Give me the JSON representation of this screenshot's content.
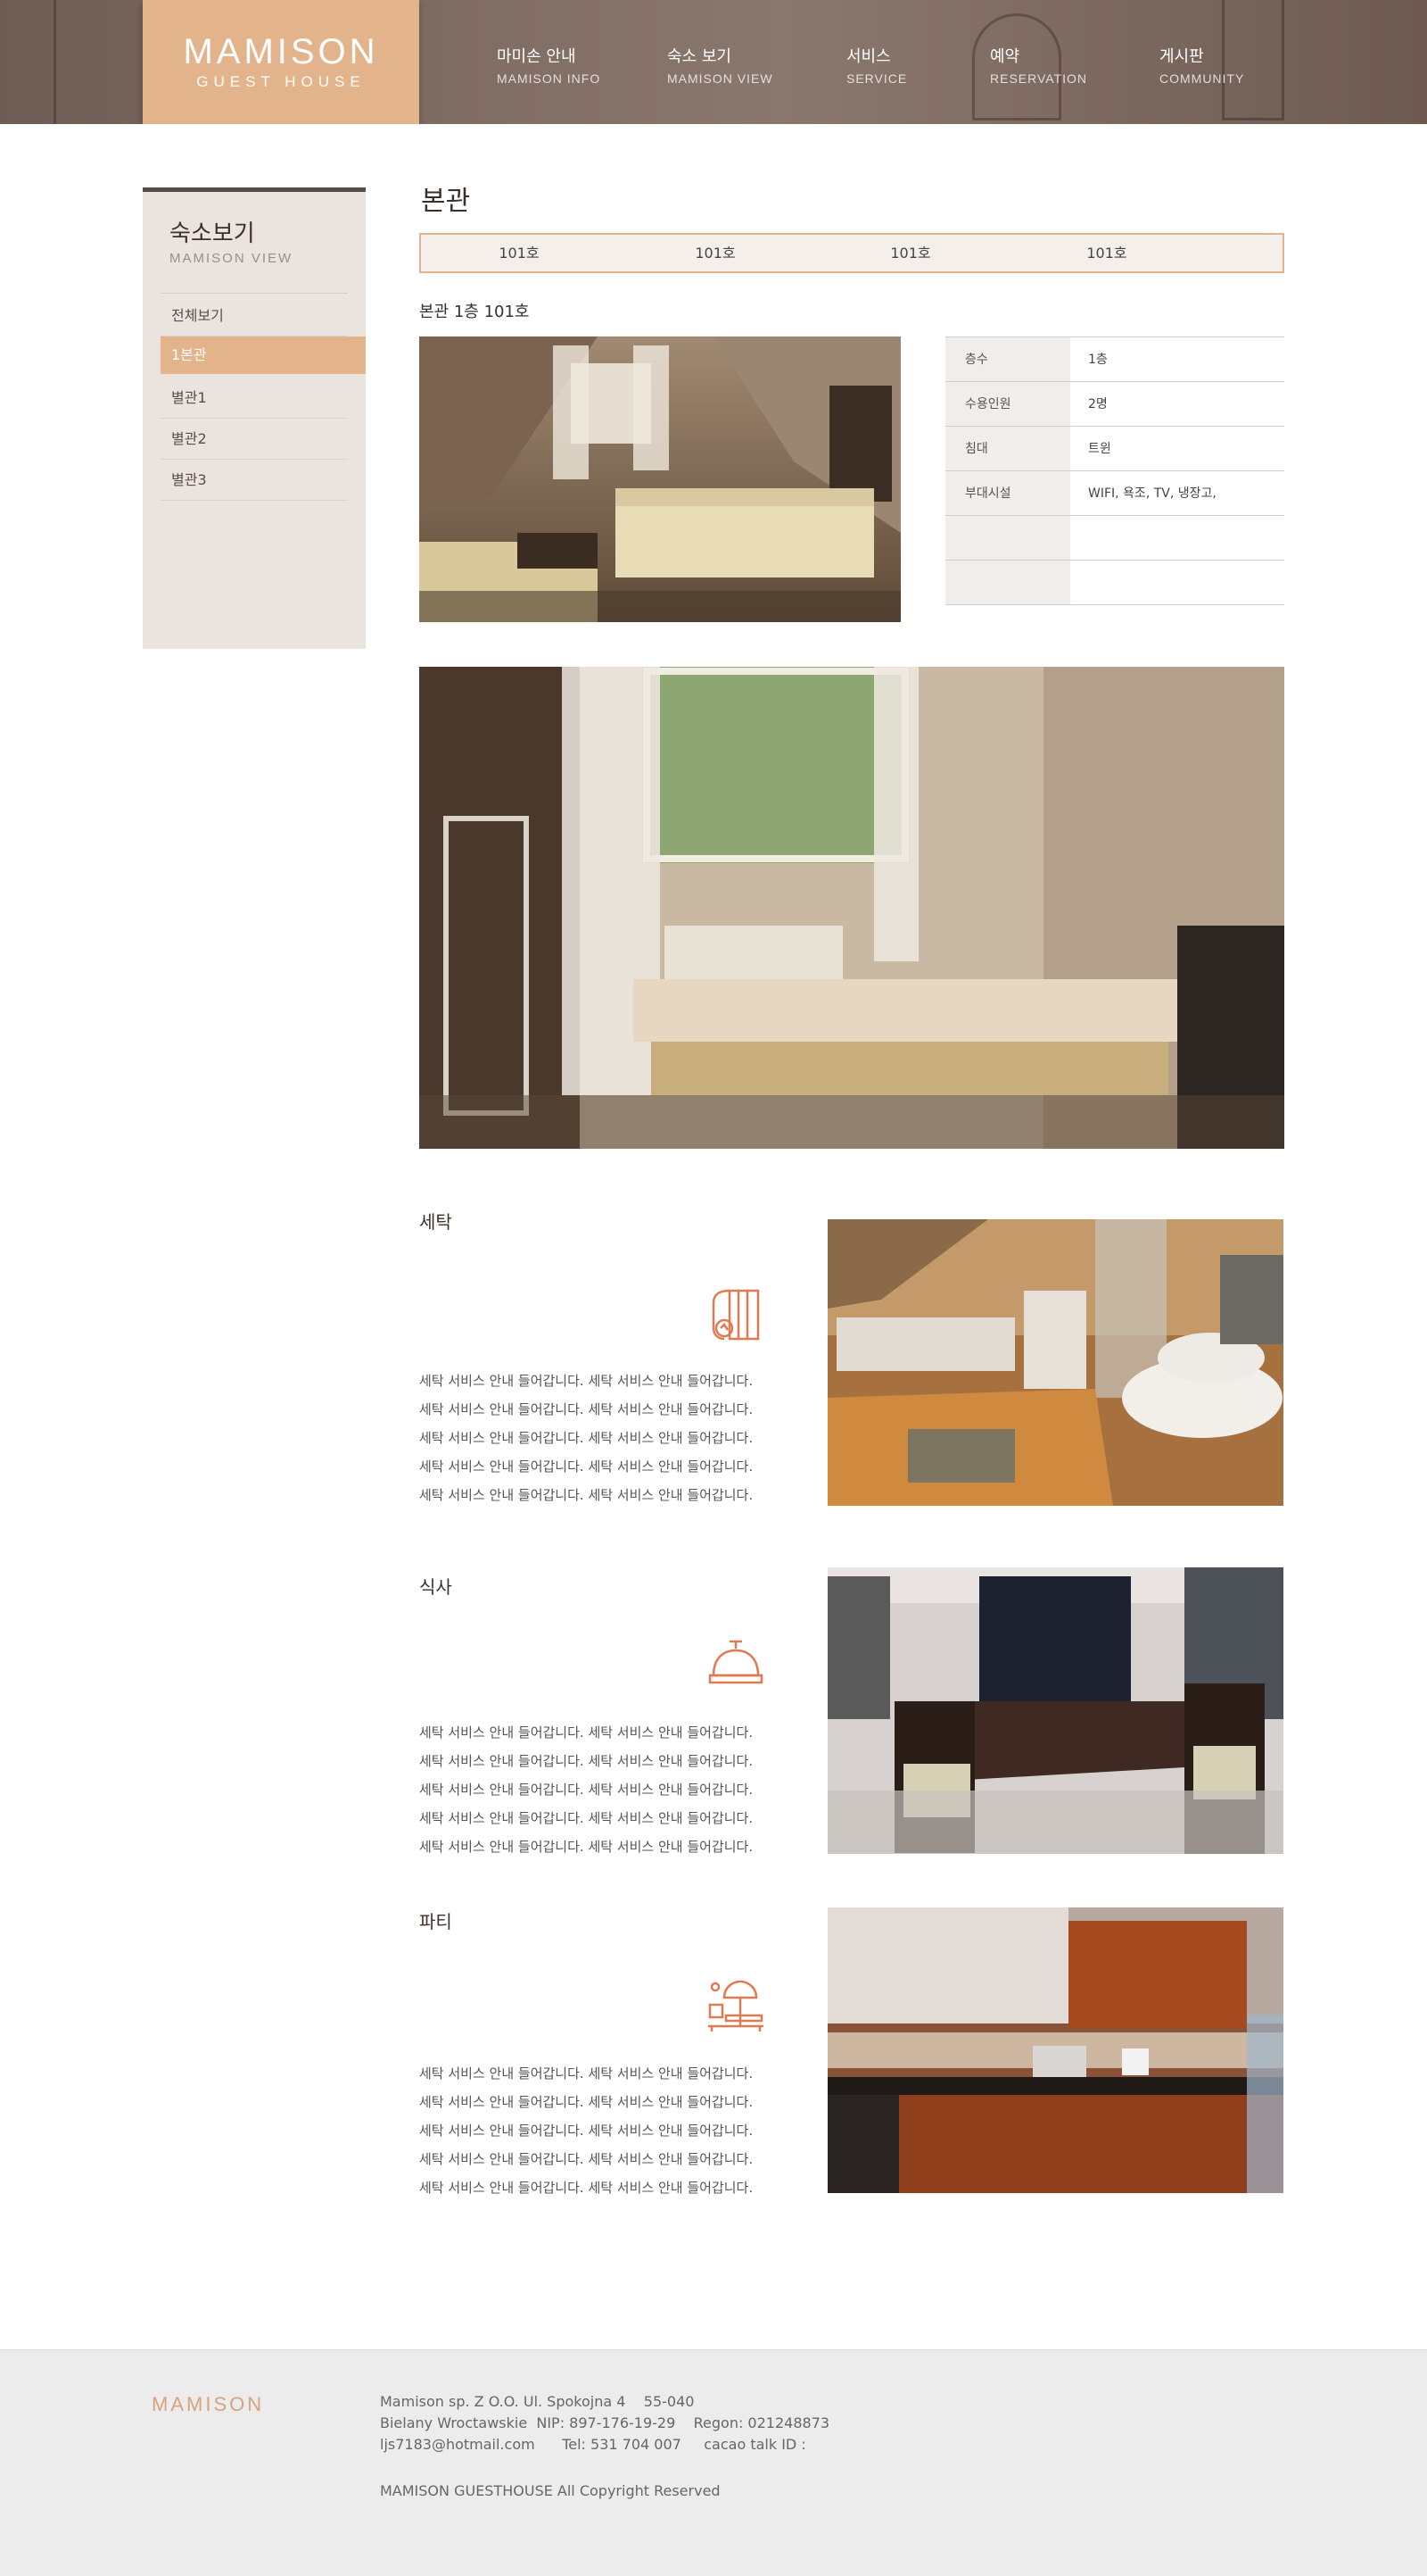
{
  "brand": {
    "line1": "MAMISON",
    "line2": "GUEST HOUSE"
  },
  "nav": [
    {
      "ko": "마미손 안내",
      "en": "MAMISON INFO"
    },
    {
      "ko": "숙소 보기",
      "en": "MAMISON VIEW"
    },
    {
      "ko": "서비스",
      "en": "SERVICE"
    },
    {
      "ko": "예약",
      "en": "RESERVATION"
    },
    {
      "ko": "게시판",
      "en": "COMMUNITY"
    }
  ],
  "sidebar": {
    "title": "숙소보기",
    "subtitle": "MAMISON VIEW",
    "items": [
      {
        "label": "전체보기"
      },
      {
        "label": "1본관"
      },
      {
        "label": "별관1"
      },
      {
        "label": "별관2"
      },
      {
        "label": "별관3"
      }
    ]
  },
  "page": {
    "title": "본관",
    "room_tabs": [
      "101호",
      "101호",
      "101호",
      "101호"
    ],
    "room_subtitle": "본관 1층 101호"
  },
  "info_table": [
    {
      "key": "층수",
      "value": "1층"
    },
    {
      "key": "수용인원",
      "value": "2명"
    },
    {
      "key": "침대",
      "value": "트윈"
    },
    {
      "key": "부대시설",
      "value": "WIFI, 욕조, TV, 냉장고,"
    },
    {
      "key": "",
      "value": ""
    },
    {
      "key": "",
      "value": ""
    }
  ],
  "sections": [
    {
      "title": "세탁",
      "icon": "laundry-icon",
      "lines": [
        "세탁 서비스 안내 들어갑니다. 세탁 서비스 안내 들어갑니다.",
        "세탁 서비스 안내 들어갑니다. 세탁 서비스 안내 들어갑니다.",
        "세탁 서비스 안내 들어갑니다. 세탁 서비스 안내 들어갑니다.",
        "세탁 서비스 안내 들어갑니다. 세탁 서비스 안내 들어갑니다.",
        "세탁 서비스 안내 들어갑니다. 세탁 서비스 안내 들어갑니다."
      ]
    },
    {
      "title": "식사",
      "icon": "service-bell-icon",
      "lines": [
        "세탁 서비스 안내 들어갑니다. 세탁 서비스 안내 들어갑니다.",
        "세탁 서비스 안내 들어갑니다. 세탁 서비스 안내 들어갑니다.",
        "세탁 서비스 안내 들어갑니다. 세탁 서비스 안내 들어갑니다.",
        "세탁 서비스 안내 들어갑니다. 세탁 서비스 안내 들어갑니다.",
        "세탁 서비스 안내 들어갑니다. 세탁 서비스 안내 들어갑니다."
      ]
    },
    {
      "title": "파티",
      "icon": "party-table-icon",
      "lines": [
        "세탁 서비스 안내 들어갑니다. 세탁 서비스 안내 들어갑니다.",
        "세탁 서비스 안내 들어갑니다. 세탁 서비스 안내 들어갑니다.",
        "세탁 서비스 안내 들어갑니다. 세탁 서비스 안내 들어갑니다.",
        "세탁 서비스 안내 들어갑니다. 세탁 서비스 안내 들어갑니다.",
        "세탁 서비스 안내 들어갑니다. 세탁 서비스 안내 들어갑니다."
      ]
    }
  ],
  "footer": {
    "logo": "MAMISON",
    "line1": "Mamison sp. Z O.O. Ul. Spokojna 4    55-040",
    "line2": "Bielany Wroctawskie  NIP: 897-176-19-29    Regon: 021248873",
    "line3": "ljs7183@hotmail.com      Tel: 531 704 007     cacao talk ID :",
    "copyright": "MAMISON GUESTHOUSE All Copyright Reserved"
  },
  "colors": {
    "accent": "#e3b38c",
    "header_bg": "#7e6b62",
    "sidebar_bg": "#ebe3dd",
    "icon": "#e07a52"
  }
}
